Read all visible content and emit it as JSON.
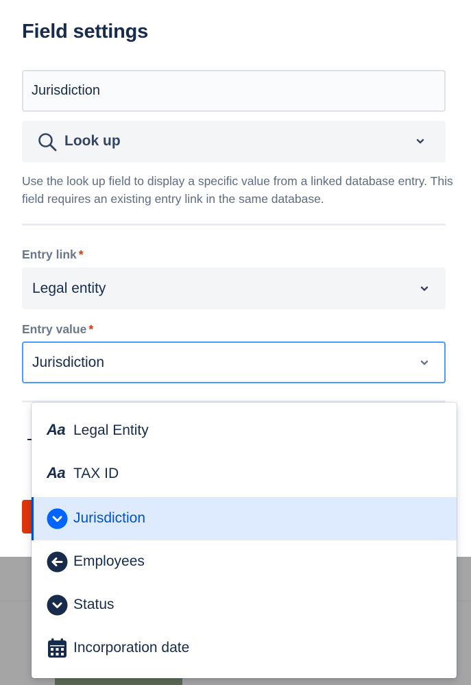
{
  "panel": {
    "title": "Field settings",
    "name_input_value": "Jurisdiction",
    "field_type": {
      "label": "Look up",
      "icon": "search-icon"
    },
    "help_text": "Use the look up field to display a specific value from a linked database entry. This field requires an existing entry link in the same database."
  },
  "entry_link": {
    "label": "Entry link",
    "required_mark": "*",
    "value": "Legal entity"
  },
  "entry_value": {
    "label": "Entry value",
    "required_mark": "*",
    "value": "Jurisdiction"
  },
  "dropdown": {
    "options": [
      {
        "label": "Legal Entity",
        "icon": "text-type-icon",
        "icon_glyph": "Aa"
      },
      {
        "label": "TAX ID",
        "icon": "text-type-icon",
        "icon_glyph": "Aa"
      },
      {
        "label": "Jurisdiction",
        "icon": "select-type-icon",
        "selected": true
      },
      {
        "label": "Employees",
        "icon": "link-type-icon"
      },
      {
        "label": "Status",
        "icon": "select-type-icon"
      },
      {
        "label": "Incorporation date",
        "icon": "calendar-icon"
      }
    ]
  },
  "colors": {
    "title": "#172b4d",
    "required": "#de350b",
    "focus_border": "#4c9aff",
    "selected_bg": "#deebff",
    "selected_text": "#0052cc",
    "selected_icon": "#0065ff",
    "icon_dark": "#172b4d"
  }
}
